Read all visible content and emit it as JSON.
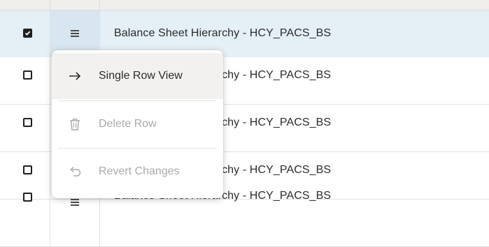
{
  "rows": [
    {
      "selected": true,
      "label": "Balance Sheet Hierarchy - HCY_PACS_BS"
    },
    {
      "selected": false,
      "label": "Balance Sheet Hierarchy - HCY_PACS_BS"
    },
    {
      "selected": false,
      "label": "Balance Sheet Hierarchy - HCY_PACS_BS"
    },
    {
      "selected": false,
      "label": "Balance Sheet Hierarchy - HCY_PACS_BS"
    },
    {
      "selected": false,
      "label": "Balance Sheet Hierarchy - HCY_PACS_BS"
    }
  ],
  "context_menu": {
    "items": [
      {
        "label": "Single Row View",
        "icon": "arrow-right-icon",
        "enabled": true
      },
      {
        "label": "Delete Row",
        "icon": "trash-icon",
        "enabled": false
      },
      {
        "label": "Revert Changes",
        "icon": "undo-icon",
        "enabled": false
      }
    ]
  },
  "colors": {
    "selected_row": "#e4eff6",
    "active_menu_button": "#d7e6f0",
    "disabled_text": "#a9a9a9"
  }
}
